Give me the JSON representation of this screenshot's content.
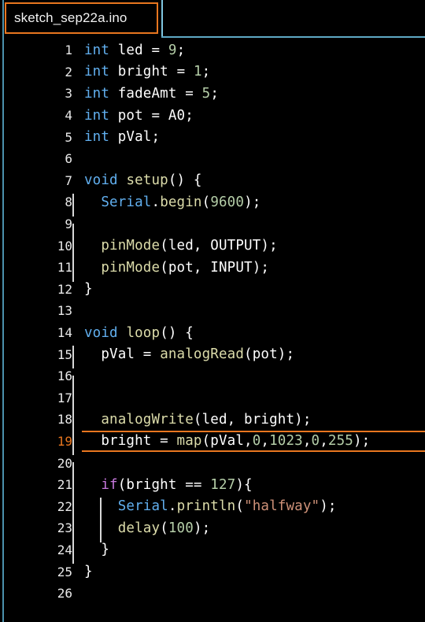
{
  "window": {
    "accent_rail_color": "#4b91ad",
    "background_color": "#000000"
  },
  "tab_bar": {
    "active_tab": {
      "label": "sketch_sep22a.ino",
      "border_color": "#e8761f"
    },
    "underline_color": "#7fc6e0"
  },
  "editor": {
    "highlight_color": "#e8761f",
    "highlighted_line": 19,
    "total_lines": 26,
    "theme_colors": {
      "keyword": "#61afef",
      "control": "#c678dd",
      "function": "#dcdcaa",
      "number": "#b5cea8",
      "string": "#ce9178",
      "plain": "#ffffff",
      "line_number": "#e9e9e9"
    },
    "lines": [
      {
        "n": "1",
        "indent": 0,
        "tokens": [
          {
            "t": "int",
            "c": "kw"
          },
          {
            "t": " led ",
            "c": "plain"
          },
          {
            "t": "= ",
            "c": "punc"
          },
          {
            "t": "9",
            "c": "num"
          },
          {
            "t": ";",
            "c": "punc"
          }
        ]
      },
      {
        "n": "2",
        "indent": 0,
        "tokens": [
          {
            "t": "int",
            "c": "kw"
          },
          {
            "t": " bright ",
            "c": "plain"
          },
          {
            "t": "= ",
            "c": "punc"
          },
          {
            "t": "1",
            "c": "num"
          },
          {
            "t": ";",
            "c": "punc"
          }
        ]
      },
      {
        "n": "3",
        "indent": 0,
        "tokens": [
          {
            "t": "int",
            "c": "kw"
          },
          {
            "t": " fadeAmt ",
            "c": "plain"
          },
          {
            "t": "= ",
            "c": "punc"
          },
          {
            "t": "5",
            "c": "num"
          },
          {
            "t": ";",
            "c": "punc"
          }
        ]
      },
      {
        "n": "4",
        "indent": 0,
        "tokens": [
          {
            "t": "int",
            "c": "kw"
          },
          {
            "t": " pot ",
            "c": "plain"
          },
          {
            "t": "= ",
            "c": "punc"
          },
          {
            "t": "A0",
            "c": "plain"
          },
          {
            "t": ";",
            "c": "punc"
          }
        ]
      },
      {
        "n": "5",
        "indent": 0,
        "tokens": [
          {
            "t": "int",
            "c": "kw"
          },
          {
            "t": " pVal;",
            "c": "plain"
          }
        ]
      },
      {
        "n": "6",
        "indent": 0,
        "tokens": []
      },
      {
        "n": "7",
        "indent": 0,
        "tokens": [
          {
            "t": "void",
            "c": "kw"
          },
          {
            "t": " ",
            "c": "plain"
          },
          {
            "t": "setup",
            "c": "fn"
          },
          {
            "t": "() {",
            "c": "punc"
          }
        ]
      },
      {
        "n": "8",
        "indent": 1,
        "tokens": [
          {
            "t": "  ",
            "c": "plain"
          },
          {
            "t": "Serial",
            "c": "obj"
          },
          {
            "t": ".",
            "c": "punc"
          },
          {
            "t": "begin",
            "c": "fn"
          },
          {
            "t": "(",
            "c": "punc"
          },
          {
            "t": "9600",
            "c": "num"
          },
          {
            "t": ");",
            "c": "punc"
          }
        ]
      },
      {
        "n": "9",
        "indent": 1,
        "tokens": []
      },
      {
        "n": "10",
        "indent": 1,
        "tokens": [
          {
            "t": "  ",
            "c": "plain"
          },
          {
            "t": "pinMode",
            "c": "fn"
          },
          {
            "t": "(led, OUTPUT);",
            "c": "punc"
          }
        ]
      },
      {
        "n": "11",
        "indent": 1,
        "tokens": [
          {
            "t": "  ",
            "c": "plain"
          },
          {
            "t": "pinMode",
            "c": "fn"
          },
          {
            "t": "(pot, INPUT);",
            "c": "punc"
          }
        ]
      },
      {
        "n": "12",
        "indent": 0,
        "tokens": [
          {
            "t": "}",
            "c": "punc"
          }
        ]
      },
      {
        "n": "13",
        "indent": 0,
        "tokens": []
      },
      {
        "n": "14",
        "indent": 0,
        "tokens": [
          {
            "t": "void",
            "c": "kw"
          },
          {
            "t": " ",
            "c": "plain"
          },
          {
            "t": "loop",
            "c": "fn"
          },
          {
            "t": "() {",
            "c": "punc"
          }
        ]
      },
      {
        "n": "15",
        "indent": 1,
        "tokens": [
          {
            "t": "  pVal = ",
            "c": "plain"
          },
          {
            "t": "analogRead",
            "c": "fn"
          },
          {
            "t": "(pot);",
            "c": "punc"
          }
        ]
      },
      {
        "n": "16",
        "indent": 1,
        "tokens": []
      },
      {
        "n": "17",
        "indent": 1,
        "tokens": []
      },
      {
        "n": "18",
        "indent": 1,
        "tokens": [
          {
            "t": "  ",
            "c": "plain"
          },
          {
            "t": "analogWrite",
            "c": "fn"
          },
          {
            "t": "(led, bright);",
            "c": "punc"
          }
        ]
      },
      {
        "n": "19",
        "indent": 1,
        "highlight": true,
        "tokens": [
          {
            "t": "  bright = ",
            "c": "plain"
          },
          {
            "t": "map",
            "c": "fn"
          },
          {
            "t": "(pVal,",
            "c": "punc"
          },
          {
            "t": "0",
            "c": "num"
          },
          {
            "t": ",",
            "c": "punc"
          },
          {
            "t": "1023",
            "c": "num"
          },
          {
            "t": ",",
            "c": "punc"
          },
          {
            "t": "0",
            "c": "num"
          },
          {
            "t": ",",
            "c": "punc"
          },
          {
            "t": "255",
            "c": "num"
          },
          {
            "t": ");",
            "c": "punc"
          }
        ]
      },
      {
        "n": "20",
        "indent": 1,
        "tokens": []
      },
      {
        "n": "21",
        "indent": 1,
        "tokens": [
          {
            "t": "  ",
            "c": "plain"
          },
          {
            "t": "if",
            "c": "ctrl"
          },
          {
            "t": "(bright == ",
            "c": "punc"
          },
          {
            "t": "127",
            "c": "num"
          },
          {
            "t": "){",
            "c": "punc"
          }
        ]
      },
      {
        "n": "22",
        "indent": 2,
        "tokens": [
          {
            "t": "    ",
            "c": "plain"
          },
          {
            "t": "Serial",
            "c": "obj"
          },
          {
            "t": ".",
            "c": "punc"
          },
          {
            "t": "println",
            "c": "fn"
          },
          {
            "t": "(",
            "c": "punc"
          },
          {
            "t": "\"halfway\"",
            "c": "str"
          },
          {
            "t": ");",
            "c": "punc"
          }
        ]
      },
      {
        "n": "23",
        "indent": 2,
        "tokens": [
          {
            "t": "    ",
            "c": "plain"
          },
          {
            "t": "delay",
            "c": "fn"
          },
          {
            "t": "(",
            "c": "punc"
          },
          {
            "t": "100",
            "c": "num"
          },
          {
            "t": ");",
            "c": "punc"
          }
        ]
      },
      {
        "n": "24",
        "indent": 1,
        "tokens": [
          {
            "t": "  }",
            "c": "punc"
          }
        ]
      },
      {
        "n": "25",
        "indent": 0,
        "tokens": [
          {
            "t": "}",
            "c": "punc"
          }
        ]
      },
      {
        "n": "26",
        "indent": 0,
        "tokens": []
      }
    ]
  }
}
